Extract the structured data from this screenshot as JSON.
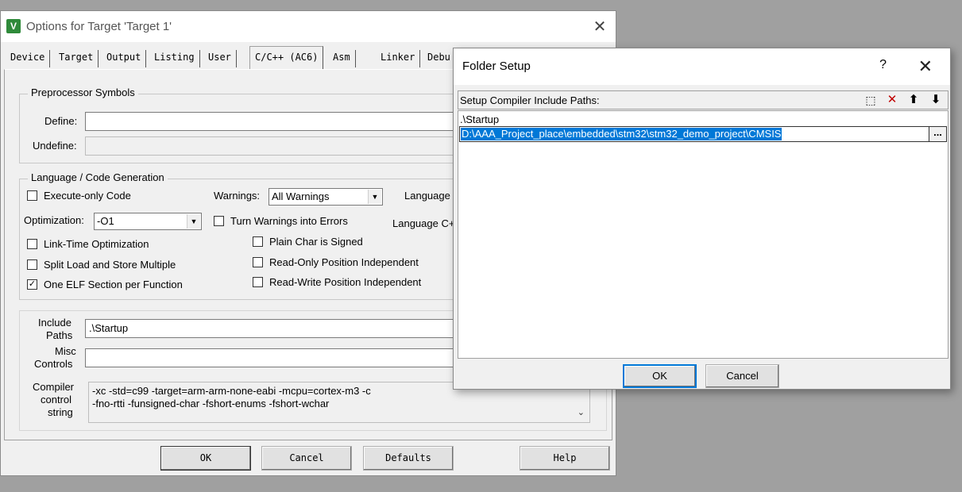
{
  "options": {
    "title": "Options for Target 'Target 1'",
    "app_icon": "V",
    "close": "✕",
    "tabs": [
      "Device",
      "Target",
      "Output",
      "Listing",
      "User",
      "C/C++ (AC6)",
      "Asm",
      "Linker",
      "Debu"
    ],
    "preprocessor": {
      "title": "Preprocessor Symbols",
      "define_label": "Define:",
      "define_value": "",
      "undefine_label": "Undefine:",
      "undefine_value": ""
    },
    "language": {
      "title": "Language / Code Generation",
      "execute_only": "Execute-only Code",
      "warnings_label": "Warnings:",
      "warnings_value": "All Warnings",
      "language_c_label": "Language",
      "optimization_label": "Optimization:",
      "optimization_value": "-O1",
      "turn_warnings": "Turn Warnings into Errors",
      "language_cpp_label": "Language C+",
      "link_time": "Link-Time Optimization",
      "plain_char": "Plain Char is Signed",
      "split_load": "Split Load and Store Multiple",
      "ro_pi": "Read-Only Position Independent",
      "one_elf": "One ELF Section per Function",
      "rw_pi": "Read-Write Position Independent",
      "checked_mark": "✓"
    },
    "include_label_1": "Include",
    "include_label_2": "Paths",
    "include_value": ".\\Startup",
    "misc_label_1": "Misc",
    "misc_label_2": "Controls",
    "misc_value": "",
    "compiler_label_1": "Compiler",
    "compiler_label_2": "control",
    "compiler_label_3": "string",
    "compiler_line_1": "-xc -std=c99 -target=arm-arm-none-eabi -mcpu=cortex-m3 -c",
    "compiler_line_2": "-fno-rtti -funsigned-char -fshort-enums -fshort-wchar",
    "buttons": {
      "ok": "OK",
      "cancel": "Cancel",
      "defaults": "Defaults",
      "help": "Help"
    }
  },
  "folder_setup": {
    "title": "Folder Setup",
    "help": "?",
    "close": "✕",
    "list_label": "Setup Compiler Include Paths:",
    "tools": {
      "new": "⬚",
      "delete": "✕",
      "up": "⬆",
      "down": "⬇"
    },
    "paths": [
      ".\\Startup"
    ],
    "editing_value": "D:\\AAA_Project_place\\embedded\\stm32\\stm32_demo_project\\CMSIS",
    "browse": "...",
    "ok": "OK",
    "cancel": "Cancel",
    "delete_color": "#c00000"
  }
}
